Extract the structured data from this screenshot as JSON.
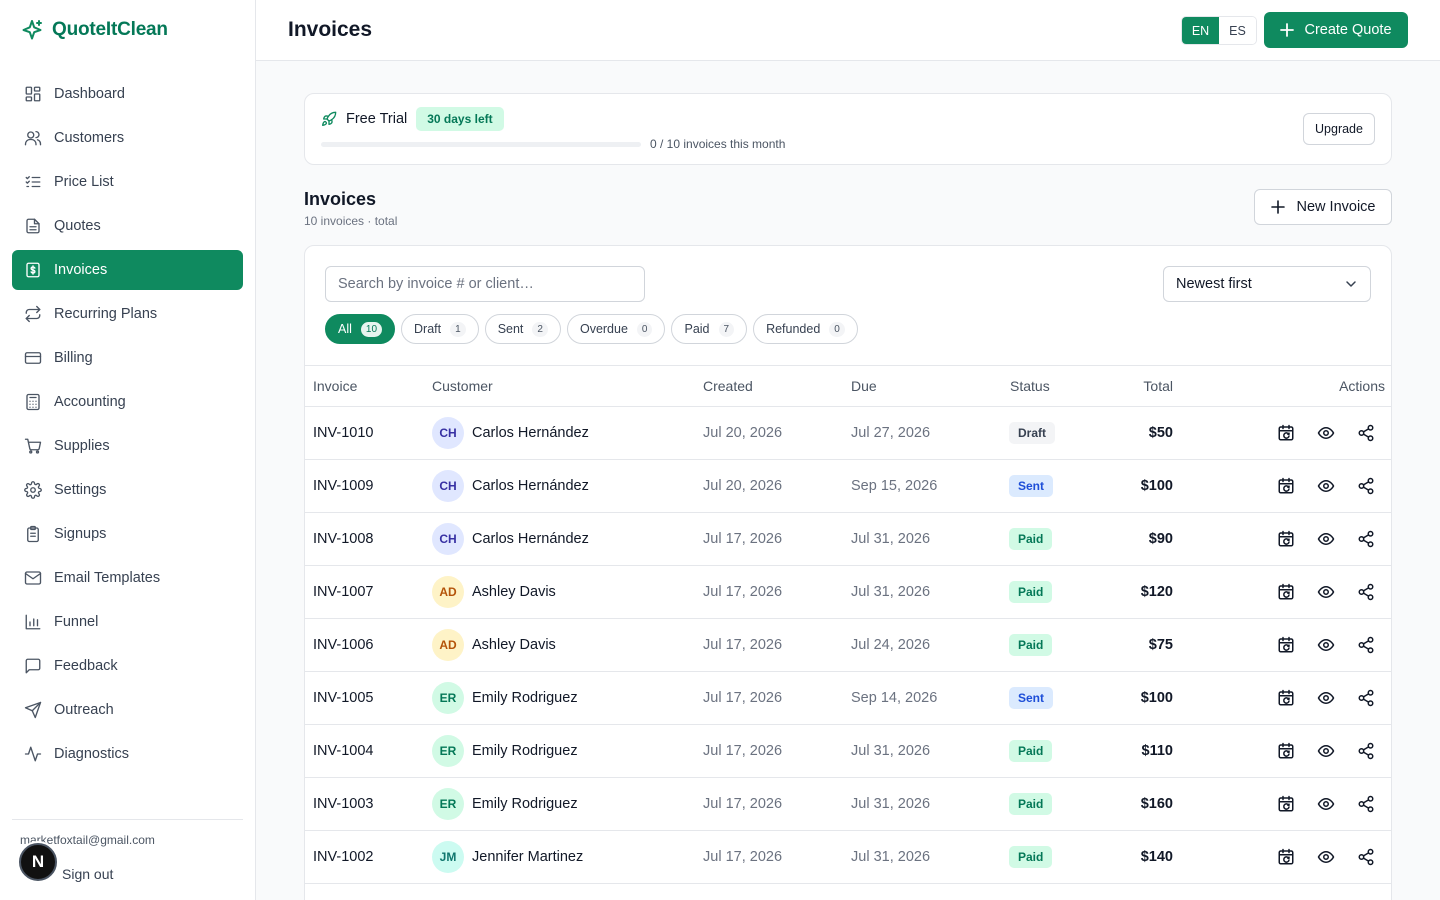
{
  "brand": {
    "name": "QuoteItClean",
    "accent": "#0f8a5f"
  },
  "sidebar": {
    "items": [
      {
        "label": "Dashboard",
        "icon": "dashboard-icon",
        "active": false
      },
      {
        "label": "Customers",
        "icon": "users-icon",
        "active": false
      },
      {
        "label": "Price List",
        "icon": "list-check-icon",
        "active": false
      },
      {
        "label": "Quotes",
        "icon": "document-icon",
        "active": false
      },
      {
        "label": "Invoices",
        "icon": "dollar-doc-icon",
        "active": true
      },
      {
        "label": "Recurring Plans",
        "icon": "repeat-icon",
        "active": false
      },
      {
        "label": "Billing",
        "icon": "credit-card-icon",
        "active": false
      },
      {
        "label": "Accounting",
        "icon": "calculator-icon",
        "active": false
      },
      {
        "label": "Supplies",
        "icon": "cart-icon",
        "active": false
      },
      {
        "label": "Settings",
        "icon": "gear-icon",
        "active": false
      },
      {
        "label": "Signups",
        "icon": "clipboard-icon",
        "active": false
      },
      {
        "label": "Email Templates",
        "icon": "mail-icon",
        "active": false
      },
      {
        "label": "Funnel",
        "icon": "bar-chart-icon",
        "active": false
      },
      {
        "label": "Feedback",
        "icon": "message-icon",
        "active": false
      },
      {
        "label": "Outreach",
        "icon": "send-icon",
        "active": false
      },
      {
        "label": "Diagnostics",
        "icon": "pulse-icon",
        "active": false
      }
    ],
    "email": "marketfoxtail@gmail.com",
    "sign_out": "Sign out",
    "avatar_letter": "N"
  },
  "header": {
    "title": "Invoices",
    "lang": [
      "EN",
      "ES"
    ],
    "lang_active": "EN",
    "create_label": "Create Quote"
  },
  "trial": {
    "label": "Free Trial",
    "badge": "30 days left",
    "progress": 0,
    "usage_text": "0 / 10 invoices this month",
    "upgrade_label": "Upgrade"
  },
  "section": {
    "title": "Invoices",
    "subtitle": "10 invoices · total",
    "new_label": "New Invoice"
  },
  "search": {
    "placeholder": "Search by invoice # or client…",
    "value": ""
  },
  "sort": {
    "value": "Newest first"
  },
  "filters": [
    {
      "label": "All",
      "count": "10",
      "active": true
    },
    {
      "label": "Draft",
      "count": "1",
      "active": false
    },
    {
      "label": "Sent",
      "count": "2",
      "active": false
    },
    {
      "label": "Overdue",
      "count": "0",
      "active": false
    },
    {
      "label": "Paid",
      "count": "7",
      "active": false
    },
    {
      "label": "Refunded",
      "count": "0",
      "active": false
    }
  ],
  "table": {
    "columns": [
      "Invoice",
      "Customer",
      "Created",
      "Due",
      "Status",
      "Total",
      "Actions"
    ],
    "rows": [
      {
        "invoice": "INV-1010",
        "initials": "CH",
        "customer": "Carlos Hernández",
        "created": "Jul 20, 2026",
        "due": "Jul 27, 2026",
        "status": "Draft",
        "total": "$50"
      },
      {
        "invoice": "INV-1009",
        "initials": "CH",
        "customer": "Carlos Hernández",
        "created": "Jul 20, 2026",
        "due": "Sep 15, 2026",
        "status": "Sent",
        "total": "$100"
      },
      {
        "invoice": "INV-1008",
        "initials": "CH",
        "customer": "Carlos Hernández",
        "created": "Jul 17, 2026",
        "due": "Jul 31, 2026",
        "status": "Paid",
        "total": "$90"
      },
      {
        "invoice": "INV-1007",
        "initials": "AD",
        "customer": "Ashley Davis",
        "created": "Jul 17, 2026",
        "due": "Jul 31, 2026",
        "status": "Paid",
        "total": "$120"
      },
      {
        "invoice": "INV-1006",
        "initials": "AD",
        "customer": "Ashley Davis",
        "created": "Jul 17, 2026",
        "due": "Jul 24, 2026",
        "status": "Paid",
        "total": "$75"
      },
      {
        "invoice": "INV-1005",
        "initials": "ER",
        "customer": "Emily Rodriguez",
        "created": "Jul 17, 2026",
        "due": "Sep 14, 2026",
        "status": "Sent",
        "total": "$100"
      },
      {
        "invoice": "INV-1004",
        "initials": "ER",
        "customer": "Emily Rodriguez",
        "created": "Jul 17, 2026",
        "due": "Jul 31, 2026",
        "status": "Paid",
        "total": "$110"
      },
      {
        "invoice": "INV-1003",
        "initials": "ER",
        "customer": "Emily Rodriguez",
        "created": "Jul 17, 2026",
        "due": "Jul 31, 2026",
        "status": "Paid",
        "total": "$160"
      },
      {
        "invoice": "INV-1002",
        "initials": "JM",
        "customer": "Jennifer Martinez",
        "created": "Jul 17, 2026",
        "due": "Jul 31, 2026",
        "status": "Paid",
        "total": "$140"
      }
    ],
    "actions": [
      "calendar-repeat-icon",
      "eye-icon",
      "share-icon"
    ]
  }
}
